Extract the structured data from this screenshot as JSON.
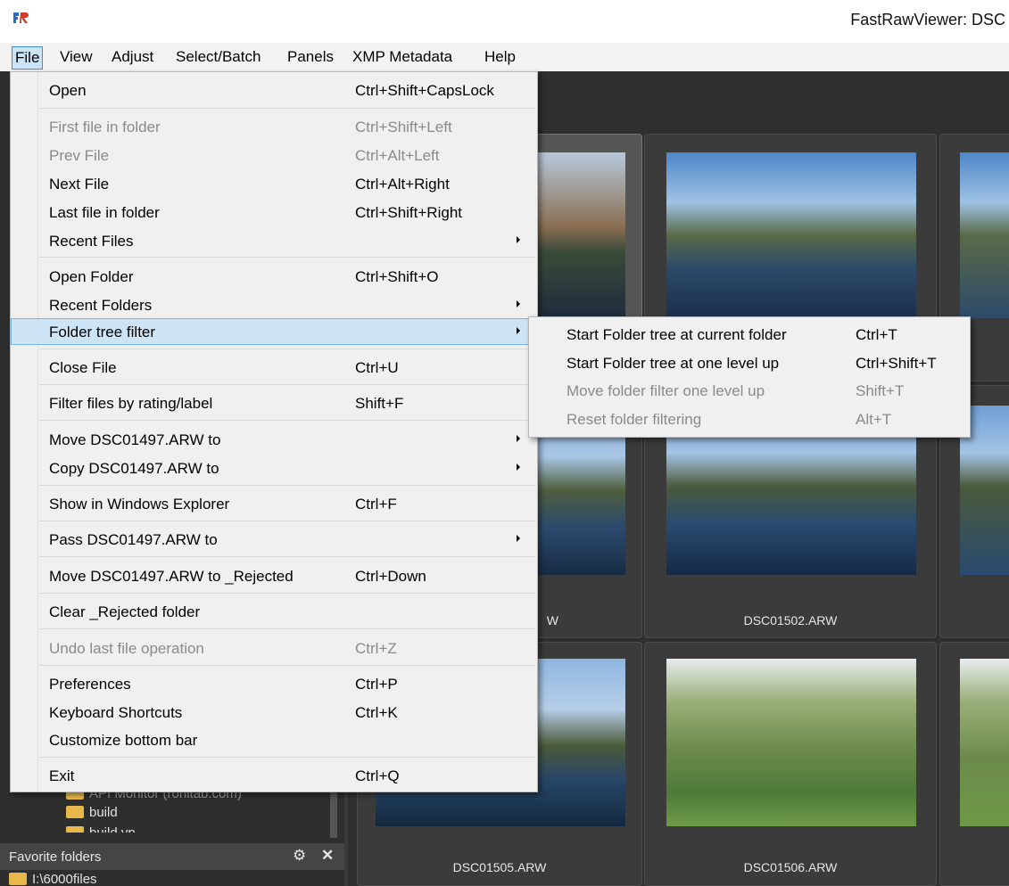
{
  "window": {
    "title": "FastRawViewer: DSC"
  },
  "menubar": [
    "File",
    "View",
    "Adjust",
    "Select/Batch",
    "Panels",
    "XMP Metadata",
    "Help"
  ],
  "file_menu": {
    "items": [
      {
        "label": "Open",
        "shortcut": "Ctrl+Shift+CapsLock",
        "enabled": true
      },
      {
        "label": "First file in folder",
        "shortcut": "Ctrl+Shift+Left",
        "enabled": false
      },
      {
        "label": "Prev File",
        "shortcut": "Ctrl+Alt+Left",
        "enabled": false
      },
      {
        "label": "Next File",
        "shortcut": "Ctrl+Alt+Right",
        "enabled": true
      },
      {
        "label": "Last file in folder",
        "shortcut": "Ctrl+Shift+Right",
        "enabled": true
      },
      {
        "label": "Recent Files",
        "shortcut": "",
        "enabled": true,
        "submenu": true
      },
      {
        "label": "Open Folder",
        "shortcut": "Ctrl+Shift+O",
        "enabled": true
      },
      {
        "label": "Recent Folders",
        "shortcut": "",
        "enabled": true,
        "submenu": true
      },
      {
        "label": "Folder tree filter",
        "shortcut": "",
        "enabled": true,
        "submenu": true,
        "highlighted": true
      },
      {
        "label": "Close File",
        "shortcut": "Ctrl+U",
        "enabled": true
      },
      {
        "label": "Filter files by rating/label",
        "shortcut": "Shift+F",
        "enabled": true
      },
      {
        "label": "Move DSC01497.ARW to",
        "shortcut": "",
        "enabled": true,
        "submenu": true
      },
      {
        "label": "Copy DSC01497.ARW to",
        "shortcut": "",
        "enabled": true,
        "submenu": true
      },
      {
        "label": "Show in Windows Explorer",
        "shortcut": "Ctrl+F",
        "enabled": true
      },
      {
        "label": "Pass DSC01497.ARW to",
        "shortcut": "",
        "enabled": true,
        "submenu": true
      },
      {
        "label": "Move DSC01497.ARW to _Rejected",
        "shortcut": "Ctrl+Down",
        "enabled": true
      },
      {
        "label": "Clear _Rejected folder",
        "shortcut": "",
        "enabled": true
      },
      {
        "label": "Undo last file operation",
        "shortcut": "Ctrl+Z",
        "enabled": false
      },
      {
        "label": "Preferences",
        "shortcut": "Ctrl+P",
        "enabled": true
      },
      {
        "label": "Keyboard Shortcuts",
        "shortcut": "Ctrl+K",
        "enabled": true
      },
      {
        "label": "Customize bottom bar",
        "shortcut": "",
        "enabled": true
      },
      {
        "label": "Exit",
        "shortcut": "Ctrl+Q",
        "enabled": true
      }
    ]
  },
  "folder_tree_submenu": {
    "items": [
      {
        "label": "Start Folder tree at current folder",
        "shortcut": "Ctrl+T",
        "enabled": true
      },
      {
        "label": "Start Folder tree at one level up",
        "shortcut": "Ctrl+Shift+T",
        "enabled": true
      },
      {
        "label": "Move folder filter one level up",
        "shortcut": "Shift+T",
        "enabled": false
      },
      {
        "label": "Reset folder filtering",
        "shortcut": "Alt+T",
        "enabled": false
      }
    ]
  },
  "thumbnails": {
    "row2_partial_label": "W",
    "labels": [
      "DSC01502.ARW",
      "DSC01505.ARW",
      "DSC01506.ARW"
    ]
  },
  "folder_tree": {
    "items": [
      "API Monitor (rohitab.com)",
      "build",
      "build.vp"
    ]
  },
  "favorites": {
    "header": "Favorite folders",
    "items": [
      "I:\\6000files"
    ]
  },
  "colors": {
    "menu_highlight": "#cde4f7",
    "disabled_text": "#8a8a8a",
    "folder": "#e8b84a"
  }
}
